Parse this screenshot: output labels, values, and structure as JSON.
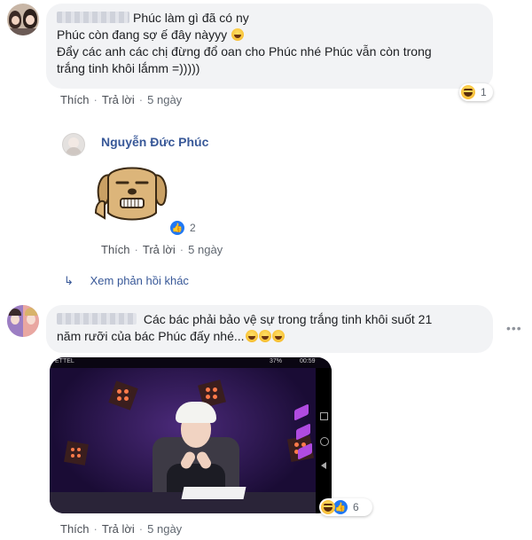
{
  "comment1": {
    "text_line1": "Phúc làm gì đã có ny",
    "text_line2": "Phúc còn đang sợ ế đây nàyyy",
    "text_line3": "Đẩy các anh các chị đừng đổ oan cho Phúc nhé Phúc vẫn còn trong",
    "text_line4": "trắng tinh khôi lắmm =)))))",
    "reaction_count": "1",
    "like_label": "Thích",
    "reply_label": "Trả lời",
    "time": "5 ngày"
  },
  "reply": {
    "author": "Nguyễn Đức Phúc",
    "reaction_count": "2",
    "like_label": "Thích",
    "reply_label": "Trả lời",
    "time": "5 ngày"
  },
  "more_replies": {
    "label": "Xem phản hồi khác"
  },
  "comment2": {
    "text_line1": "Các bác phải bảo vệ sự trong trắng tinh khôi suốt 21",
    "text_line2": "năm rưỡi của bác Phúc đấy nhé...",
    "reaction_count": "6",
    "like_label": "Thích",
    "reply_label": "Trả lời",
    "time": "5 ngày",
    "phone_carrier": "ETTEL",
    "phone_status": "37%",
    "phone_clock": "00:59"
  },
  "colors": {
    "link": "#385898",
    "bubble": "#f2f3f5",
    "meta": "#606770",
    "like_blue": "#2078f4"
  },
  "icons": {
    "reply_arrow": "reply-arrow-icon",
    "more": "more-options-icon",
    "like": "like-icon",
    "haha": "haha-icon"
  }
}
